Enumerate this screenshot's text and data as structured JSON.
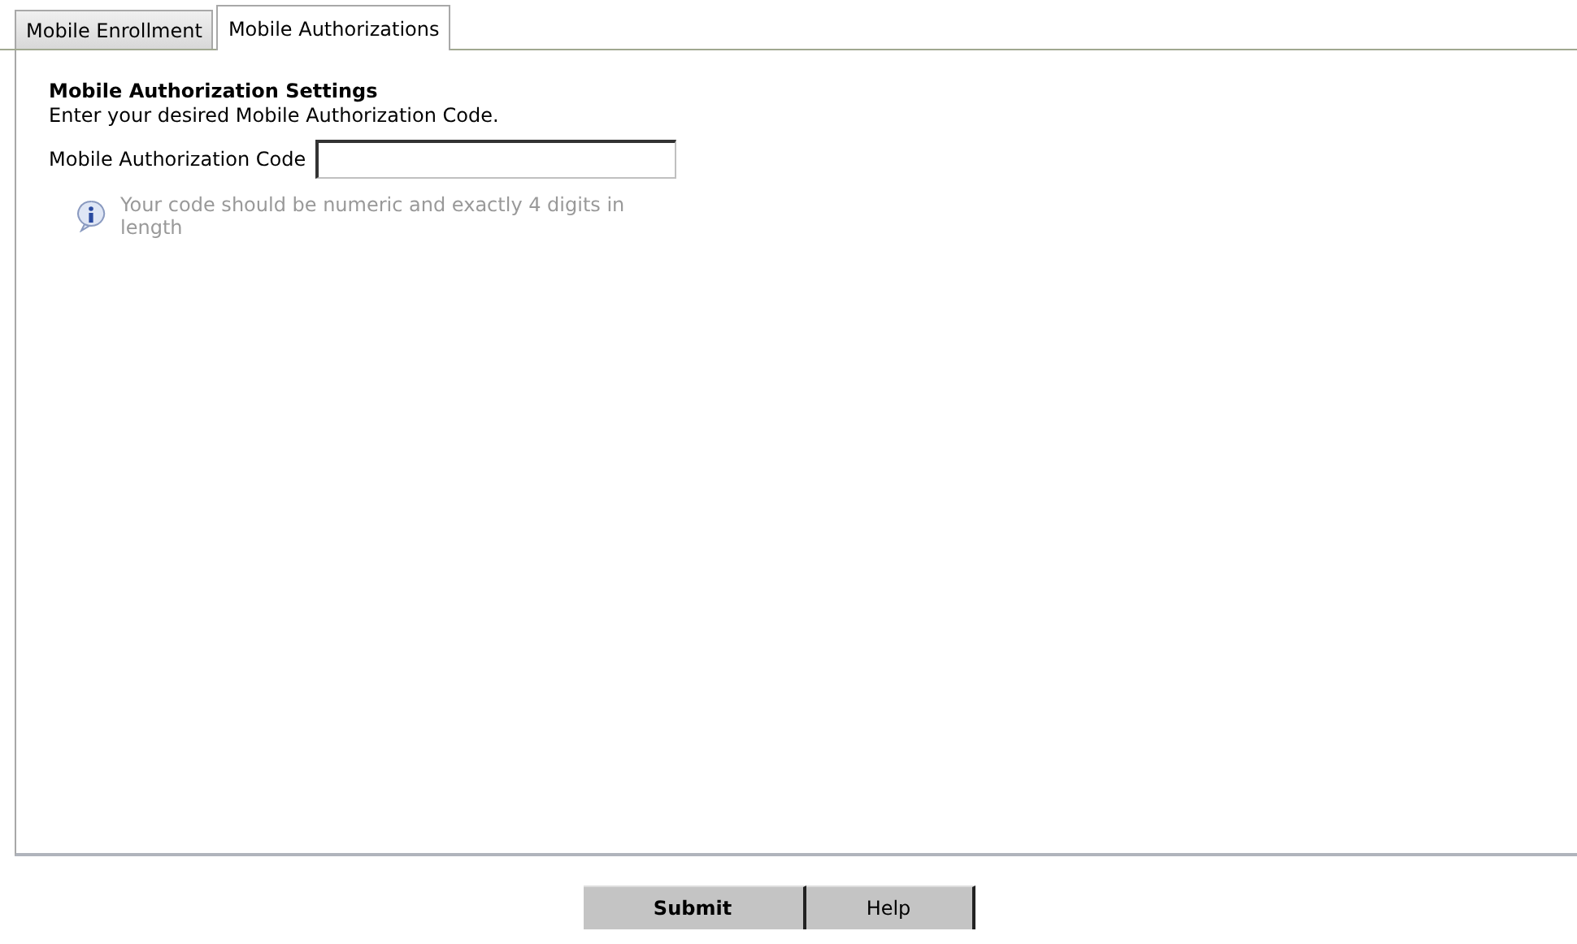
{
  "tabs": [
    {
      "label": "Mobile Enrollment",
      "selected": false
    },
    {
      "label": "Mobile Authorizations",
      "selected": true
    }
  ],
  "section": {
    "title": "Mobile Authorization Settings",
    "instructions": "Enter your desired Mobile Authorization Code.",
    "field": {
      "label": "Mobile Authorization Code"
    },
    "hint": "Your code should be numeric and exactly 4 digits in length"
  },
  "buttons": [
    {
      "label": "Submit",
      "kind": "primary"
    },
    {
      "label": "Help",
      "kind": "secondary"
    }
  ]
}
